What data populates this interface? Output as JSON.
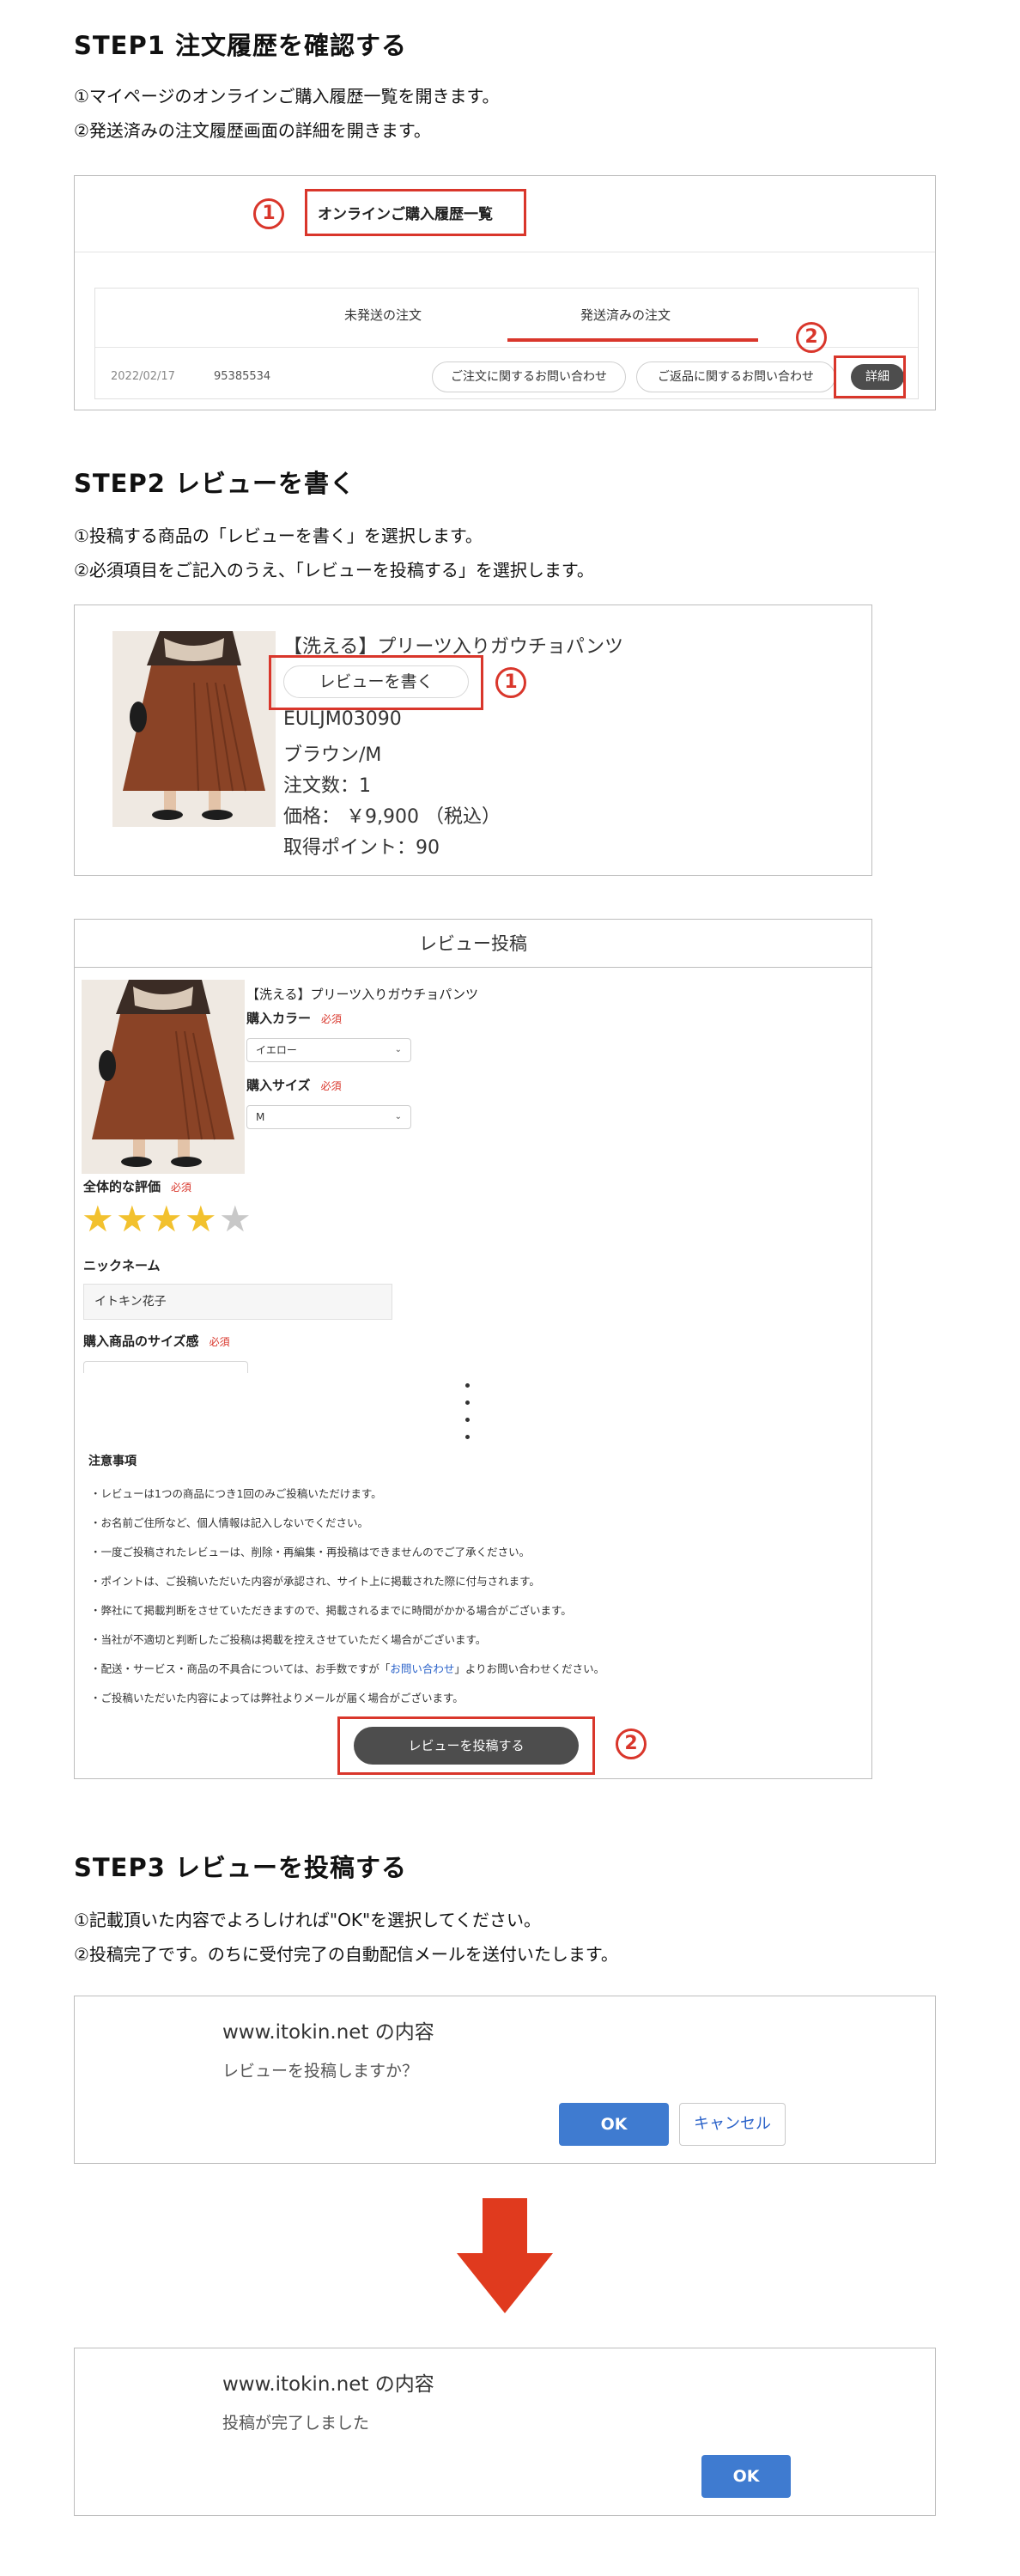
{
  "step1": {
    "heading": "STEP1 注文履歴を確認する",
    "instructions": [
      "①マイページのオンラインご購入履歴一覧を開きます。",
      "②発送済みの注文履歴画面の詳細を開きます。"
    ],
    "screen": {
      "title": "オンラインご購入履歴一覧",
      "tabs": [
        "未発送の注文",
        "発送済みの注文"
      ],
      "active_tab_index": 1,
      "order": {
        "date": "2022/02/17",
        "number": "95385534"
      },
      "buttons": [
        "ご注文に関するお問い合わせ",
        "ご返品に関するお問い合わせ",
        "詳細"
      ]
    },
    "markers": [
      "1",
      "2"
    ]
  },
  "step2": {
    "heading": "STEP2 レビューを書く",
    "instructions": [
      "①投稿する商品の「レビューを書く」を選択します。",
      "②必須項目をご記入のうえ、「レビューを投稿する」を選択します。"
    ],
    "product": {
      "name": "【洗える】プリーツ入りガウチョパンツ",
      "review_button": "レビューを書く",
      "code": "EULJM03090",
      "color_size": "ブラウン/M",
      "quantity": "注文数：1",
      "price": "価格： ￥9,900 （税込）",
      "points": "取得ポイント：90"
    },
    "form": {
      "title": "レビュー投稿",
      "product_name": "【洗える】プリーツ入りガウチョパンツ",
      "color_label": "購入カラー",
      "required": "必須",
      "color_value": "イエロー",
      "size_label": "購入サイズ",
      "size_value": "M",
      "rating_label": "全体的な評価",
      "rating": 4,
      "rating_max": 5,
      "nickname_label": "ニックネーム",
      "nickname_value": "イトキン花子",
      "fit_label": "購入商品のサイズ感",
      "notice_title": "注意事項",
      "notices": [
        "・レビューは1つの商品につき1回のみご投稿いただけます。",
        "・お名前ご住所など、個人情報は記入しないでください。",
        "・一度ご投稿されたレビューは、削除・再編集・再投稿はできませんのでご了承ください。",
        "・ポイントは、ご投稿いただいた内容が承認され、サイト上に掲載された際に付与されます。",
        "・弊社にて掲載判断をさせていただきますので、掲載されるまでに時間がかかる場合がございます。",
        "・当社が不適切と判断したご投稿は掲載を控えさせていただく場合がございます。"
      ],
      "notice_contact_pre": "・配送・サービス・商品の不具合については、お手数ですが「",
      "notice_contact_link": "お問い合わせ",
      "notice_contact_post": "」よりお問い合わせください。",
      "notice_last": "・ご投稿いただいた内容によっては弊社よりメールが届く場合がございます。",
      "submit_button": "レビューを投稿する"
    },
    "markers": [
      "1",
      "2"
    ]
  },
  "step3": {
    "heading": "STEP3 レビューを投稿する",
    "instructions": [
      "①記載頂いた内容でよろしければ\"OK\"を選択してください。",
      "②投稿完了です。のちに受付完了の自動配信メールを送付いたします。"
    ],
    "dialog1": {
      "host": "www.itokin.net の内容",
      "message": "レビューを投稿しますか？",
      "ok": "OK",
      "cancel": "キャンセル"
    },
    "dialog2": {
      "host": "www.itokin.net の内容",
      "message": "投稿が完了しました",
      "ok": "OK"
    }
  },
  "colors": {
    "accent_red": "#d9362b",
    "ok_blue": "#3f7bd0",
    "star_gold": "#f2c12e",
    "arrow_red": "#e03a1e"
  },
  "icons": [
    "star-icon",
    "chevron-down-icon",
    "down-arrow-icon",
    "ellipsis-dots-icon"
  ]
}
